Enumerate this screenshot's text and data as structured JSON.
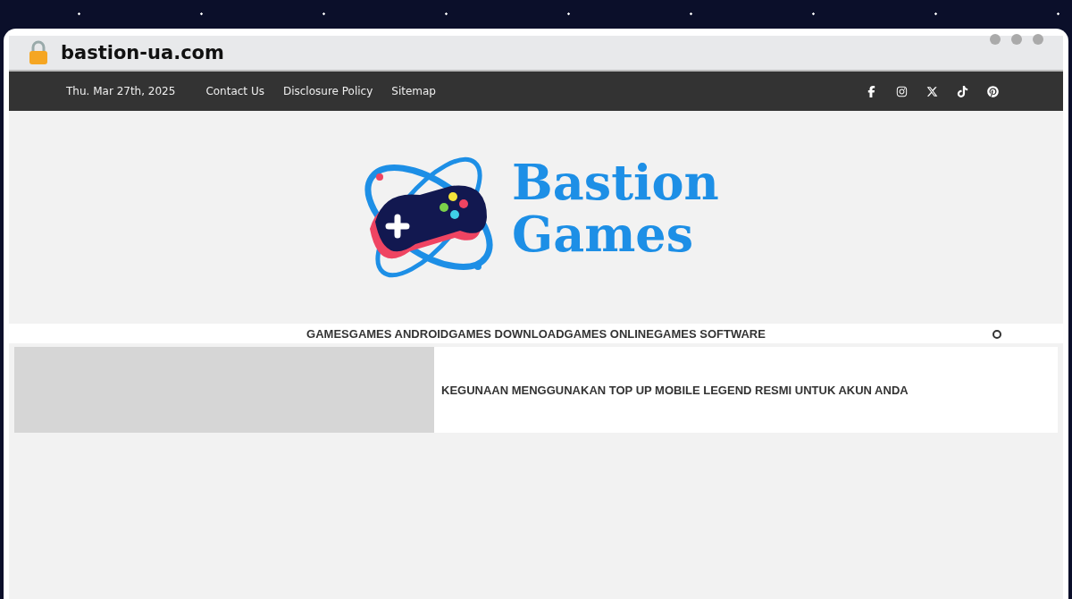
{
  "browser": {
    "url": "bastion-ua.com",
    "secure": true
  },
  "topbar": {
    "date": "Thu. Mar 27th, 2025",
    "links": [
      "Contact Us",
      "Disclosure Policy",
      "Sitemap"
    ],
    "social": [
      {
        "kind": "facebook"
      },
      {
        "kind": "instagram"
      },
      {
        "kind": "x"
      },
      {
        "kind": "tiktok"
      },
      {
        "kind": "pinterest"
      }
    ]
  },
  "logo": {
    "line_1": "Bastion",
    "line_2": "Games"
  },
  "menu": [
    "GAMES",
    "GAMES ANDROID",
    "GAMES DOWNLOAD",
    "GAMES ONLINE",
    "GAMES SOFTWARE"
  ],
  "posts": [
    {
      "title": "KEGUNAAN MENGGUNAKAN TOP UP MOBILE LEGEND RESMI UNTUK AKUN ANDA"
    }
  ]
}
